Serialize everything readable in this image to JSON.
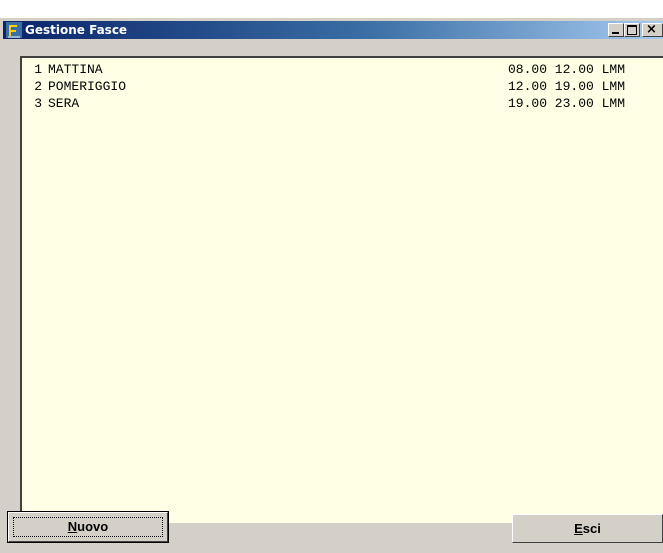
{
  "window": {
    "title": "Gestione Fasce",
    "icon": "app-icon",
    "controls": {
      "minimize": "minimize-icon",
      "maximize": "maximize-icon",
      "close": "close-icon"
    }
  },
  "list": {
    "rows": [
      {
        "num": "1",
        "name": "MATTINA",
        "times": "08.00 12.00 LMM"
      },
      {
        "num": "2",
        "name": "POMERIGGIO",
        "times": "12.00 19.00 LMM"
      },
      {
        "num": "3",
        "name": "SERA",
        "times": "19.00 23.00 LMM"
      }
    ]
  },
  "buttons": {
    "nuovo": {
      "accel": "N",
      "rest": "uovo"
    },
    "esci": {
      "accel": "E",
      "rest": "sci"
    }
  },
  "colors": {
    "list_bg": "#ffffe6",
    "title_start": "#0a246a",
    "title_end": "#a6caf0",
    "face": "#d4d0c8"
  }
}
